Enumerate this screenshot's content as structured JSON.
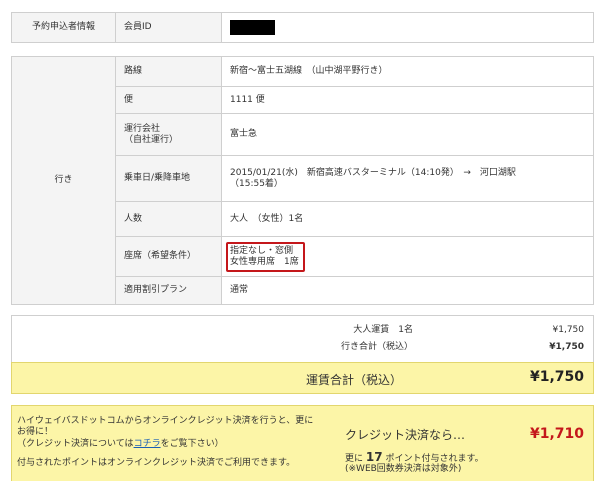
{
  "member": {
    "section_label": "予約申込者情報",
    "id_label": "会員ID"
  },
  "trip": {
    "section_label": "行き",
    "rows": [
      {
        "label": "路線",
        "value": "新宿～富士五湖線　（山中湖平野行き）"
      },
      {
        "label": "便",
        "value": "1111 便"
      },
      {
        "label": "運行会社\n（自社運行）",
        "value": "富士急"
      },
      {
        "label": "乗車日/乗降車地",
        "value": "2015/01/21(水)　新宿高速バスターミナル（14:10発）　→　河口湖駅\n（15:55着）"
      },
      {
        "label": "人数",
        "value": "大人　（女性）1名"
      },
      {
        "label": "座席（希望条件）",
        "value": "指定なし・窓側\n女性専用席　1席"
      },
      {
        "label": "適用割引プラン",
        "value": "通常"
      }
    ]
  },
  "fare": {
    "adult_label": "大人運賃　1名",
    "adult_value": "¥1,750",
    "subtotal_label": "行き合計（税込）",
    "subtotal_value": "¥1,750",
    "total_label": "運賃合計（税込）",
    "total_value": "¥1,750"
  },
  "credit": {
    "line1": "ハイウェイバスドットコムからオンラインクレジット決済を行うと、更に",
    "line2": "お得に！",
    "line3_prefix": "（クレジット決済については",
    "line3_link": "コチラ",
    "line3_suffix": "をご覧下さい）",
    "line4": "付与されたポイントはオンラインクレジット決済でご利用できます。",
    "heading": "クレジット決済なら…",
    "price": "¥1,710",
    "points_prefix": "更に",
    "points_value": "17",
    "points_suffix": "ポイント付与されます。",
    "note": "(※WEB回数券決済は対象外)"
  },
  "colors": {
    "highlight_yellow": "#fcf5a7",
    "accent_red": "#c4171b",
    "link_blue": "#1a5fb4"
  }
}
